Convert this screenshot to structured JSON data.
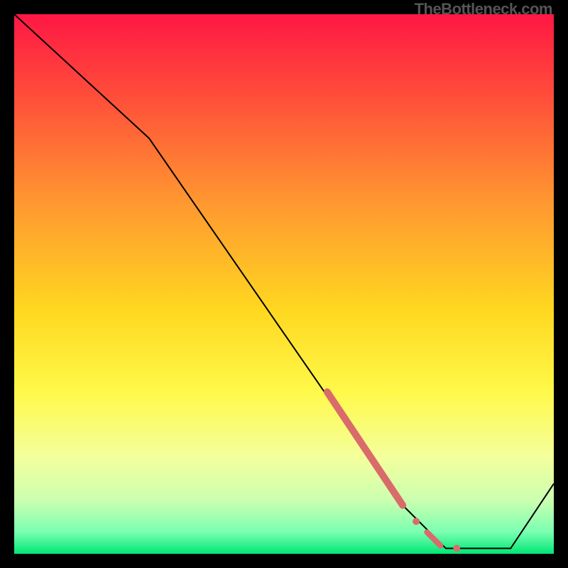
{
  "watermark": "TheBottleneck.com",
  "chart_data": {
    "type": "line",
    "title": "",
    "xlabel": "",
    "ylabel": "",
    "xlim": [
      0,
      100
    ],
    "ylim": [
      0,
      100
    ],
    "background": {
      "type": "vertical_gradient",
      "stops": [
        {
          "pos": 0.0,
          "color": "#ff1744"
        },
        {
          "pos": 0.15,
          "color": "#ff4d3a"
        },
        {
          "pos": 0.35,
          "color": "#ff9830"
        },
        {
          "pos": 0.55,
          "color": "#ffd820"
        },
        {
          "pos": 0.7,
          "color": "#fff94a"
        },
        {
          "pos": 0.82,
          "color": "#f4ff9c"
        },
        {
          "pos": 0.9,
          "color": "#ccffb0"
        },
        {
          "pos": 0.96,
          "color": "#7affb0"
        },
        {
          "pos": 1.0,
          "color": "#00e676"
        }
      ]
    },
    "series": [
      {
        "name": "curve",
        "x": [
          0,
          25,
          72,
          80,
          92,
          100
        ],
        "y": [
          100,
          77,
          9,
          1,
          1,
          13
        ],
        "stroke": "#000000",
        "width": 2
      }
    ],
    "markers": [
      {
        "name": "thick-segment",
        "type": "line_segment",
        "x": [
          58,
          72
        ],
        "y": [
          30,
          9
        ],
        "stroke": "#d96b6b",
        "width": 10,
        "cap": "round"
      },
      {
        "name": "dot-mid",
        "type": "point",
        "x": 74.5,
        "y": 6,
        "fill": "#d96b6b",
        "r": 5
      },
      {
        "name": "short-segment",
        "type": "line_segment",
        "x": [
          76.5,
          79
        ],
        "y": [
          4,
          1.5
        ],
        "stroke": "#d96b6b",
        "width": 8,
        "cap": "round"
      },
      {
        "name": "dot-end",
        "type": "point",
        "x": 82,
        "y": 1,
        "fill": "#d96b6b",
        "r": 5
      }
    ]
  }
}
